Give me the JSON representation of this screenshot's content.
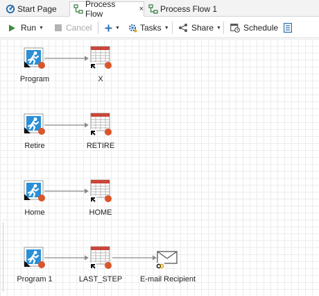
{
  "tabs": [
    {
      "label": "Start Page",
      "icon": "start-page-icon"
    },
    {
      "label": "Process Flow",
      "icon": "process-flow-icon",
      "active": true,
      "close": "×"
    },
    {
      "label": "Process Flow 1",
      "icon": "process-flow-icon"
    }
  ],
  "toolbar": {
    "run": "Run",
    "cancel": "Cancel",
    "tasks": "Tasks",
    "share": "Share",
    "schedule": "Schedule"
  },
  "flows": [
    {
      "source": "Program",
      "target": "X"
    },
    {
      "source": "Retire",
      "target": "RETIRE"
    },
    {
      "source": "Home",
      "target": "HOME"
    },
    {
      "source": "Program 1",
      "target": "LAST_STEP",
      "output": "E-mail Recipient"
    }
  ],
  "colors": {
    "accent": "#2e7cb8",
    "program_icon": "#2b8fd6",
    "status_dot": "#d9562b",
    "table_header": "#c9473a",
    "run_green": "#3c8c3c"
  }
}
